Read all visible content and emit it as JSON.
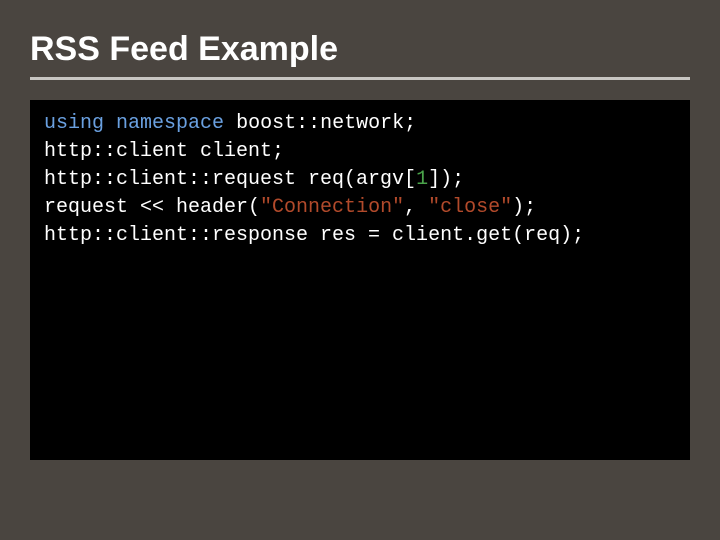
{
  "slide": {
    "title": "RSS Feed Example"
  },
  "code": {
    "l1": {
      "kw1": "using",
      "kw2": "namespace",
      "rest": " boost::network;"
    },
    "l2": {
      "rest": "http::client client;"
    },
    "l3": {
      "pre": "http::client::request req(argv[",
      "num": "1",
      "post": "]);"
    },
    "l4": {
      "pre": "request << header(",
      "s1": "\"Connection\"",
      "mid": ", ",
      "s2": "\"close\"",
      "post": ");"
    },
    "l5": {
      "rest": "http::client::response res = client.get(req);"
    }
  }
}
